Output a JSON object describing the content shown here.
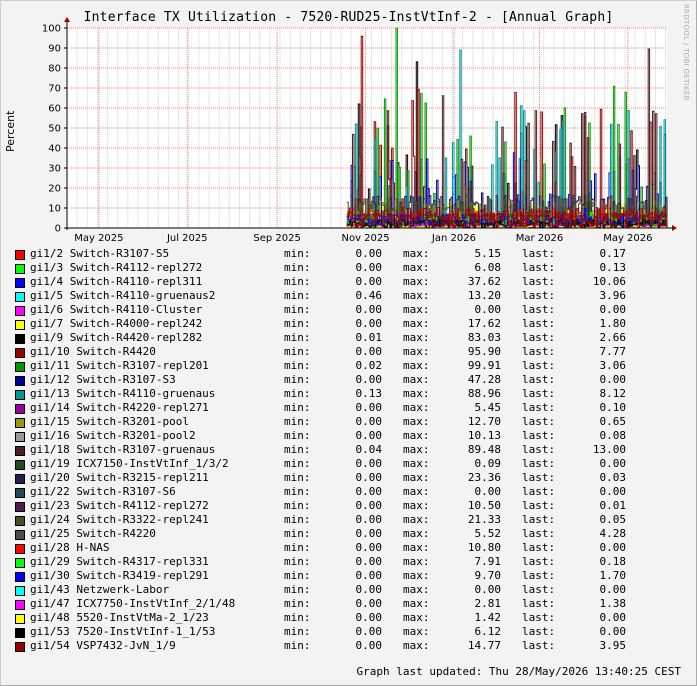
{
  "title": "Interface TX Utilization - 7520-RUD25-InstVtInf-2 - [Annual Graph]",
  "watermark": "RRDTOOL / TOBI OETIKER",
  "last_updated": "Graph last updated: Thu 28/May/2026 13:40:25 CEST",
  "labels": {
    "min": "min:",
    "max": "max:",
    "last": "last:"
  },
  "colors": {
    "background": "#f3f3f3",
    "plot_bg": "#ffffff",
    "grid": "#ff8080",
    "axis": "#000000"
  },
  "chart_data": {
    "type": "line",
    "ylabel": "Percent",
    "ylim": [
      0,
      100
    ],
    "yticks": [
      0,
      10,
      20,
      30,
      40,
      50,
      60,
      70,
      80,
      90,
      100
    ],
    "xlabels": [
      "May 2025",
      "Jul 2025",
      "Sep 2025",
      "Nov 2025",
      "Jan 2026",
      "Mar 2026",
      "May 2026"
    ],
    "xtick_dates": [
      "2025-05-01",
      "2025-07-01",
      "2025-09-01",
      "2025-11-01",
      "2026-01-01",
      "2026-03-01",
      "2026-05-01"
    ],
    "x_range": [
      "2025-04-09",
      "2026-05-28"
    ],
    "data_start": "2025-10-19",
    "grid": true,
    "series": [
      {
        "name": "gi1/2 Switch-R3107-S5",
        "color": "#ff0000",
        "min": "0.00",
        "max": "5.15",
        "last": "0.17"
      },
      {
        "name": "gi1/3 Switch-R4112-repl272",
        "color": "#00ff00",
        "min": "0.00",
        "max": "6.08",
        "last": "0.13"
      },
      {
        "name": "gi1/4 Switch-R4110-repl311",
        "color": "#0000ff",
        "min": "0.00",
        "max": "37.62",
        "last": "10.06"
      },
      {
        "name": "gi1/5 Switch-R4110-gruenaus2",
        "color": "#00ffff",
        "min": "0.46",
        "max": "13.20",
        "last": "3.96"
      },
      {
        "name": "gi1/6 Switch-R4110-Cluster",
        "color": "#ff00ff",
        "min": "0.00",
        "max": "0.00",
        "last": "0.00"
      },
      {
        "name": "gi1/7 Switch-R4000-repl242",
        "color": "#ffff00",
        "min": "0.00",
        "max": "17.62",
        "last": "1.80"
      },
      {
        "name": "gi1/9 Switch-R4420-repl282",
        "color": "#000000",
        "min": "0.01",
        "max": "83.03",
        "last": "2.66"
      },
      {
        "name": "gi1/10 Switch-R4420",
        "color": "#990000",
        "min": "0.00",
        "max": "95.90",
        "last": "7.77"
      },
      {
        "name": "gi1/11 Switch-R3107-repl201",
        "color": "#009900",
        "min": "0.02",
        "max": "99.91",
        "last": "3.06"
      },
      {
        "name": "gi1/12 Switch-R3107-S3",
        "color": "#000099",
        "min": "0.00",
        "max": "47.28",
        "last": "0.00"
      },
      {
        "name": "gi1/13 Switch-R4110-gruenaus",
        "color": "#009999",
        "min": "0.13",
        "max": "88.96",
        "last": "8.12"
      },
      {
        "name": "gi1/14 Switch-R4220-repl271",
        "color": "#990099",
        "min": "0.00",
        "max": "5.45",
        "last": "0.10"
      },
      {
        "name": "gi1/15 Switch-R3201-pool",
        "color": "#999900",
        "min": "0.00",
        "max": "12.70",
        "last": "0.65"
      },
      {
        "name": "gi1/16 Switch-R3201-pool2",
        "color": "#999999",
        "min": "0.00",
        "max": "10.13",
        "last": "0.08"
      },
      {
        "name": "gi1/18 Switch-R3107-gruenaus",
        "color": "#4d1f1f",
        "min": "0.04",
        "max": "89.48",
        "last": "13.00"
      },
      {
        "name": "gi1/19 ICX7150-InstVtInf_1/3/2",
        "color": "#1f4d1f",
        "min": "0.00",
        "max": "0.09",
        "last": "0.00"
      },
      {
        "name": "gi1/20 Switch-R3215-repl211",
        "color": "#1f1f4d",
        "min": "0.00",
        "max": "23.36",
        "last": "0.03"
      },
      {
        "name": "gi1/22 Switch-R3107-S6",
        "color": "#1f4d4d",
        "min": "0.00",
        "max": "0.00",
        "last": "0.00"
      },
      {
        "name": "gi1/23 Switch-R4112-repl272",
        "color": "#4d1f4d",
        "min": "0.00",
        "max": "10.50",
        "last": "0.01"
      },
      {
        "name": "gi1/24 Switch-R3322-repl241",
        "color": "#4d4d1f",
        "min": "0.00",
        "max": "21.33",
        "last": "0.05"
      },
      {
        "name": "gi1/25 Switch-R4220",
        "color": "#4d4d4d",
        "min": "0.00",
        "max": "5.52",
        "last": "4.28"
      },
      {
        "name": "gi1/28 H-NAS",
        "color": "#ff0000",
        "min": "0.00",
        "max": "10.80",
        "last": "0.00"
      },
      {
        "name": "gi1/29 Switch-R4317-repl331",
        "color": "#00ff00",
        "min": "0.00",
        "max": "7.91",
        "last": "0.18"
      },
      {
        "name": "gi1/30 Switch-R3419-repl291",
        "color": "#0000ff",
        "min": "0.00",
        "max": "9.70",
        "last": "1.70"
      },
      {
        "name": "gi1/43 Netzwerk-Labor",
        "color": "#00ffff",
        "min": "0.00",
        "max": "0.00",
        "last": "0.00"
      },
      {
        "name": "gi1/47 ICX7750-InstVtInf_2/1/48",
        "color": "#ff00ff",
        "min": "0.00",
        "max": "2.81",
        "last": "1.38"
      },
      {
        "name": "gi1/48 5520-InstVtMa-2_1/23",
        "color": "#ffff00",
        "min": "0.00",
        "max": "1.42",
        "last": "0.00"
      },
      {
        "name": "gi1/53 7520-InstVtInf-1_1/53",
        "color": "#000000",
        "min": "0.00",
        "max": "6.12",
        "last": "0.00"
      },
      {
        "name": "gi1/54 VSP7432-JvN_1/9",
        "color": "#990000",
        "min": "0.00",
        "max": "14.77",
        "last": "3.95"
      }
    ]
  }
}
